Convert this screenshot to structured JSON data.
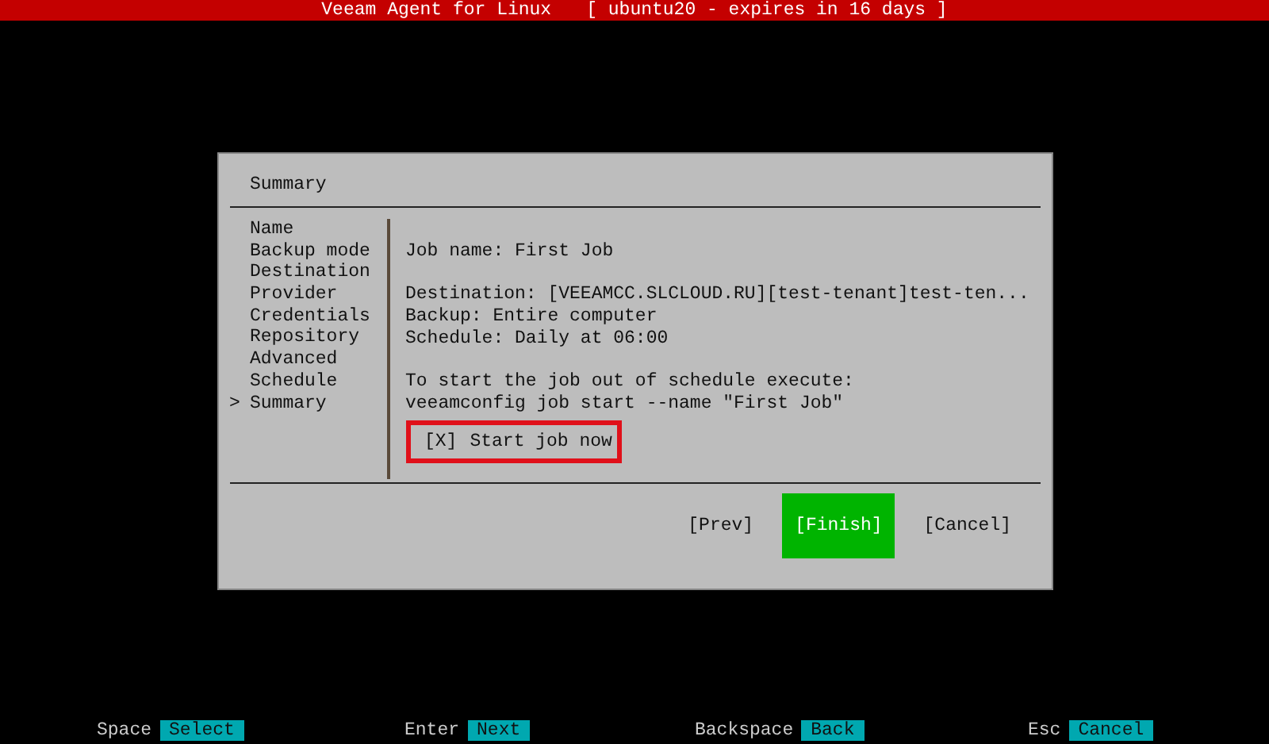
{
  "title_bar": {
    "app": "Veeam Agent for Linux",
    "license": "[ ubuntu20 - expires in 16 days ]"
  },
  "dialog": {
    "heading": "Summary",
    "selection_marker": ">",
    "steps": [
      {
        "label": "Name",
        "selected": false
      },
      {
        "label": "Backup mode",
        "selected": false
      },
      {
        "label": "Destination",
        "selected": false
      },
      {
        "label": "Provider",
        "selected": false
      },
      {
        "label": "Credentials",
        "selected": false
      },
      {
        "label": "Repository",
        "selected": false
      },
      {
        "label": "Advanced",
        "selected": false
      },
      {
        "label": "Schedule",
        "selected": false
      },
      {
        "label": "Summary",
        "selected": true
      }
    ],
    "paragraphs": [
      [
        "Job name: First Job"
      ],
      [
        "Destination: [VEEAMCC.SLCLOUD.RU][test-tenant]test-ten...",
        "Backup: Entire computer",
        "Schedule: Daily at 06:00"
      ],
      [
        "To start the job out of schedule execute:",
        "veeamconfig job start --name \"First Job\""
      ]
    ],
    "checkbox": {
      "box": "[X]",
      "label": "Start job now",
      "highlighted": true
    },
    "buttons": [
      {
        "label": "[Prev]",
        "selected": false
      },
      {
        "label": "[Finish]",
        "selected": true
      },
      {
        "label": "[Cancel]",
        "selected": false
      }
    ]
  },
  "footer": [
    {
      "key": "Space",
      "action": "Select"
    },
    {
      "key": "Enter",
      "action": "Next"
    },
    {
      "key": "Backspace",
      "action": "Back"
    },
    {
      "key": "Esc",
      "action": "Cancel"
    }
  ]
}
